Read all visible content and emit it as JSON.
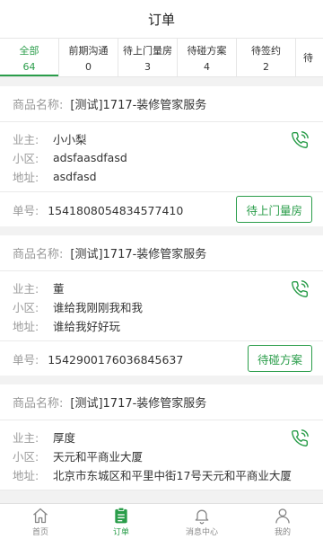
{
  "header": {
    "title": "订单"
  },
  "tabs": [
    {
      "label": "全部",
      "count": "64",
      "active": true
    },
    {
      "label": "前期沟通",
      "count": "0"
    },
    {
      "label": "待上门量房",
      "count": "3"
    },
    {
      "label": "待碰方案",
      "count": "4"
    },
    {
      "label": "待签约",
      "count": "2"
    },
    {
      "label": "待"
    }
  ],
  "labels": {
    "product": "商品名称:",
    "owner": "业主:",
    "community": "小区:",
    "address": "地址:",
    "order_no": "单号:"
  },
  "orders": [
    {
      "product": "[测试]1717-装修管家服务",
      "owner": "小小梨",
      "community": "adsfaasdfasd",
      "address": "asdfasd",
      "order_no": "1541808054834577410",
      "status_button": "待上门量房"
    },
    {
      "product": "[测试]1717-装修管家服务",
      "owner": "董",
      "community": "谁给我刚刚我和我",
      "address": "谁给我好好玩",
      "order_no": "1542900176036845637",
      "status_button": "待碰方案"
    },
    {
      "product": "[测试]1717-装修管家服务",
      "owner": "厚度",
      "community": "天元和平商业大厦",
      "address": "北京市东城区和平里中街17号天元和平商业大厦"
    }
  ],
  "bottom_nav": [
    {
      "label": "首页",
      "icon": "home-icon"
    },
    {
      "label": "订单",
      "icon": "clipboard-icon",
      "active": true
    },
    {
      "label": "消息中心",
      "icon": "bell-icon"
    },
    {
      "label": "我的",
      "icon": "user-icon"
    }
  ],
  "colors": {
    "accent": "#2a9d4a",
    "background": "#f2f2f2",
    "label_gray": "#999999"
  }
}
